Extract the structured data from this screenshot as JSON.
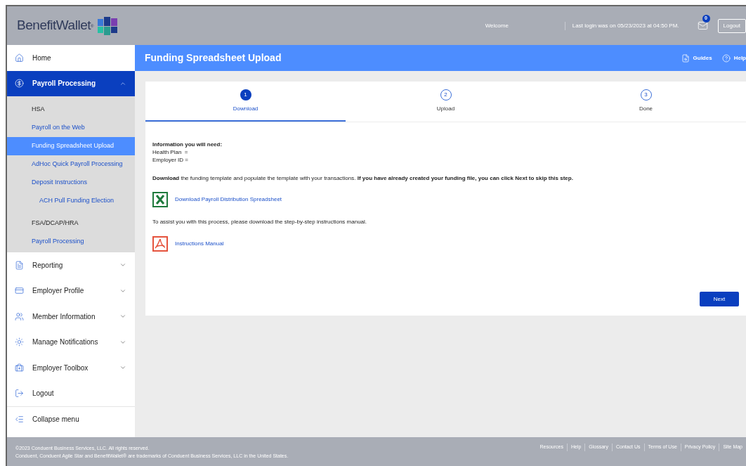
{
  "header": {
    "logo": "BenefitWallet$^{®}$",
    "welcome": "Welcome",
    "last_login": "Last login was on 05/23/2023 at 04:50 PM.",
    "message_count": "0",
    "logout": "Logout"
  },
  "sidebar": {
    "items": [
      {
        "label": "Home",
        "kind": "link"
      },
      {
        "label": "Payroll Processing",
        "kind": "section",
        "expanded": true,
        "selected": true,
        "children": [
          {
            "label": "HSA",
            "kind": "heading"
          },
          {
            "label": "Payroll on the Web",
            "kind": "link",
            "selected": false
          },
          {
            "label": "Funding Spreadsheet Upload",
            "kind": "link",
            "selected": true
          },
          {
            "label": "AdHoc Quick Payroll Processing",
            "kind": "link",
            "selected": false
          },
          {
            "label": "Deposit Instructions",
            "kind": "link",
            "selected": false,
            "children": [
              {
                "label": "ACH Pull Funding Election",
                "kind": "link",
                "selected": false
              }
            ]
          },
          {
            "label": "FSA/DCAP/HRA",
            "kind": "heading"
          },
          {
            "label": "Payroll Processing",
            "kind": "link",
            "selected": false
          }
        ]
      },
      {
        "label": "Reporting",
        "kind": "section",
        "expanded": false,
        "selected": false
      },
      {
        "label": "Employer Profile",
        "kind": "section",
        "expanded": false,
        "selected": false
      },
      {
        "label": "Member Information",
        "kind": "section",
        "expanded": false,
        "selected": false
      },
      {
        "label": "Manage Notifications",
        "kind": "section",
        "expanded": false,
        "selected": false
      },
      {
        "label": "Employer Toolbox",
        "kind": "section",
        "expanded": false,
        "selected": false
      },
      {
        "label": "Logout",
        "kind": "link"
      },
      {
        "label": "Collapse menu",
        "kind": "collapse"
      }
    ]
  },
  "page": {
    "title": "Funding Spreadsheet Upload",
    "guides": "Guides",
    "help": "Help"
  },
  "steps": [
    {
      "number": "1",
      "label": "Download",
      "selected": true
    },
    {
      "number": "2",
      "label": "Upload",
      "selected": false
    },
    {
      "number": "3",
      "label": "Done",
      "selected": false
    }
  ],
  "content": {
    "info_heading": "Information you will need:",
    "info_lines": [
      "Health Plan  =",
      "Employer ID ="
    ],
    "instruction": "**Download** the funding template and populate the template with your transactions. **If you have already created your funding file, you can click Next to skip this step.**",
    "files": [
      {
        "kind": "spreadsheet",
        "label": "Download Payroll Distribution Spreadsheet"
      }
    ],
    "assist": "To assist you with this process, please download the step-by-step instructions manual.",
    "manuals": [
      {
        "kind": "pdf",
        "label": "Instructions Manual"
      }
    ],
    "next": "Next"
  },
  "footer": {
    "copyright": "©2023 Conduent Business Services, LLC. All rights reserved.",
    "trademark": "Conduent, Conduent Agile Star and BenefitWallet® are trademarks of Conduent Business Services, LLC in the United States.",
    "links": [
      "Resources",
      "Help",
      "Glossary",
      "Contact Us",
      "Terms of Use",
      "Privacy Policy",
      "Site Map"
    ]
  }
}
